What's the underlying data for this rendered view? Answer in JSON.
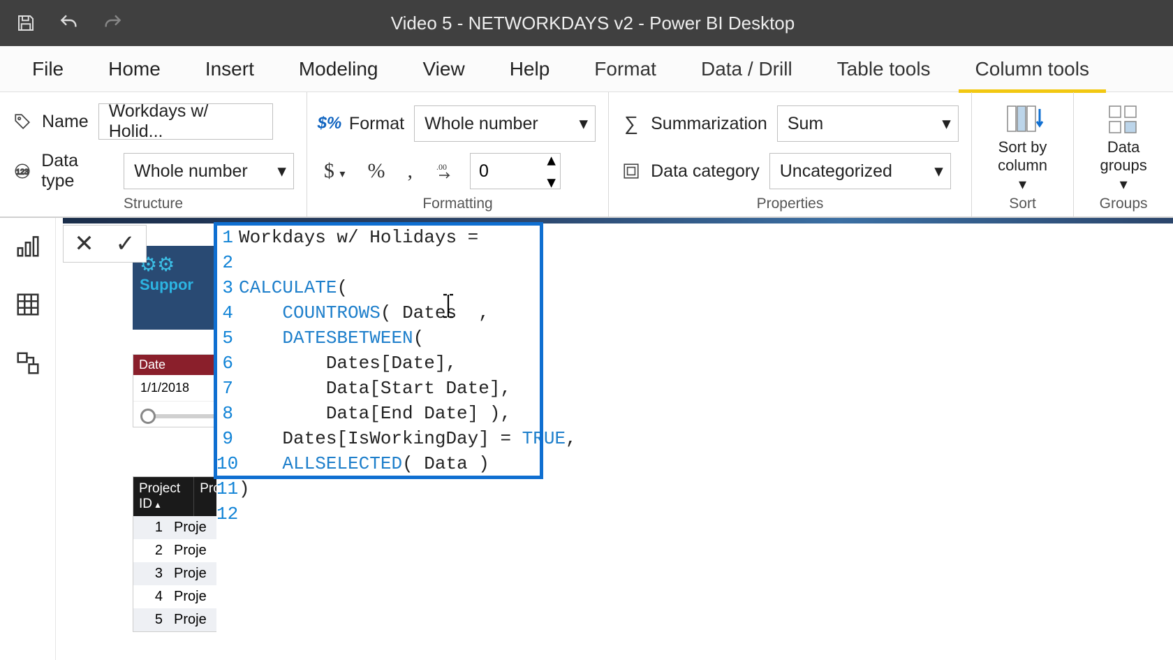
{
  "title": "Video 5 - NETWORKDAYS v2 - Power BI Desktop",
  "menu": {
    "file": "File",
    "home": "Home",
    "insert": "Insert",
    "modeling": "Modeling",
    "view": "View",
    "help": "Help",
    "format": "Format",
    "datadrill": "Data / Drill",
    "tabletools": "Table tools",
    "columntools": "Column tools"
  },
  "ribbon": {
    "structure": {
      "label": "Structure",
      "name_label": "Name",
      "name_value": "Workdays w/ Holid...",
      "datatype_label": "Data type",
      "datatype_value": "Whole number"
    },
    "formatting": {
      "label": "Formatting",
      "format_label": "Format",
      "format_value": "Whole number",
      "decimals_value": "0"
    },
    "properties": {
      "label": "Properties",
      "summarization_label": "Summarization",
      "summarization_value": "Sum",
      "datacategory_label": "Data category",
      "datacategory_value": "Uncategorized"
    },
    "sort": {
      "label": "Sort",
      "button": "Sort by\ncolumn"
    },
    "groups": {
      "label": "Groups",
      "button": "Data\ngroups"
    }
  },
  "formula": {
    "lines": [
      {
        "n": "1",
        "pre": "",
        "plain": "Workdays w/ Holidays = "
      },
      {
        "n": "2",
        "pre": "",
        "plain": ""
      },
      {
        "n": "3",
        "pre": "",
        "func": "CALCULATE",
        "post": "("
      },
      {
        "n": "4",
        "pre": "    ",
        "func": "COUNTROWS",
        "post": "( Dates  ,"
      },
      {
        "n": "5",
        "pre": "    ",
        "func": "DATESBETWEEN",
        "post": "("
      },
      {
        "n": "6",
        "pre": "        ",
        "plain": "Dates[Date],"
      },
      {
        "n": "7",
        "pre": "        ",
        "plain": "Data[Start Date],"
      },
      {
        "n": "8",
        "pre": "        ",
        "plain": "Data[End Date] ),"
      },
      {
        "n": "9",
        "pre": "    ",
        "plain_a": "Dates[IsWorkingDay] = ",
        "true": "TRUE",
        "plain_b": ","
      },
      {
        "n": "10",
        "pre": "    ",
        "func": "ALLSELECTED",
        "post": "( Data )"
      },
      {
        "n": "11",
        "pre": "",
        "plain": ")"
      },
      {
        "n": "12",
        "pre": "",
        "plain": ""
      }
    ]
  },
  "bg_visual": {
    "text": "Suppor"
  },
  "slicer": {
    "header": "Date",
    "value": "1/1/2018"
  },
  "table": {
    "col1": "Project ID",
    "col2": "Proj",
    "rows": [
      {
        "id": "1",
        "name": "Proje"
      },
      {
        "id": "2",
        "name": "Proje"
      },
      {
        "id": "3",
        "name": "Proje"
      },
      {
        "id": "4",
        "name": "Proje"
      },
      {
        "id": "5",
        "name": "Proje"
      }
    ]
  }
}
